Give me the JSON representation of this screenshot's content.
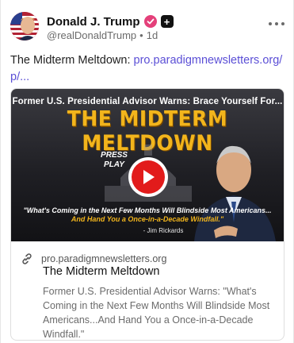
{
  "author": {
    "display_name": "Donald J. Trump",
    "handle": "@realDonaldTrump",
    "separator": "•",
    "time_ago": "1d",
    "verified_icon": "verified-check-icon",
    "badge_icon": "plus-badge-icon",
    "badge_symbol": "+"
  },
  "post": {
    "text": "The Midterm Meltdown: ",
    "link_text": "pro.paradigmnewsletters.org/p/..."
  },
  "card": {
    "thumbnail": {
      "top_line": "Former U.S. Presidential Advisor Warns: Brace Yourself For...",
      "headline": "THE MIDTERM MELTDOWN",
      "press_play": "PRESS PLAY",
      "quote_line1": "\"What's Coming in the Next Few Months Will Blindside Most Americans...",
      "quote_line2": "And Hand You a Once-in-a-Decade Windfall.\"",
      "quote_author": "- Jim Rickards"
    },
    "domain": "pro.paradigmnewsletters.org",
    "title": "The Midterm Meltdown",
    "description": "Former U.S. Presidential Advisor Warns: \"What's Coming in the Next Few Months Will Blindside Most Americans...And Hand You a Once-in-a-Decade Windfall.\""
  },
  "colors": {
    "link": "#5b4fd6",
    "verified": "#e4407a",
    "headline_gold": "#f2b51c",
    "play_red": "#e21b1b"
  }
}
